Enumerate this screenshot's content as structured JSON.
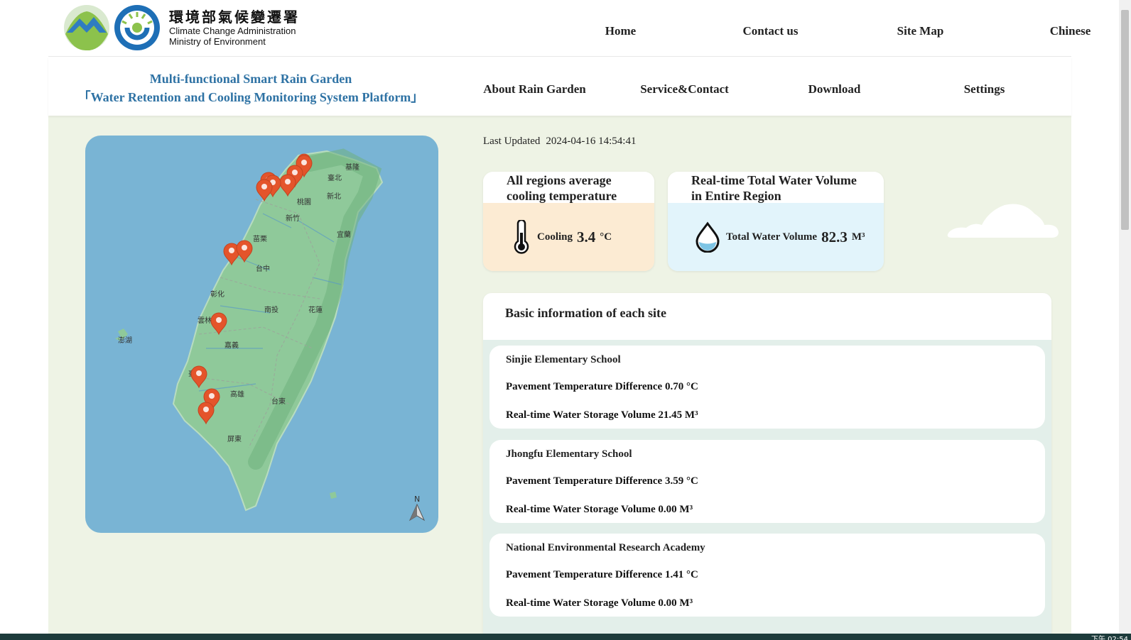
{
  "logo": {
    "name_zh": "環境部氣候變遷署",
    "name_en_1": "Climate Change Administration",
    "name_en_2": "Ministry of Environment"
  },
  "top_nav": [
    "Home",
    "Contact us",
    "Site Map",
    "Chinese"
  ],
  "platform": {
    "title_line1": "Multi-functional Smart Rain Garden",
    "title_line2": "「Water Retention and Cooling Monitoring System Platform」"
  },
  "sub_nav": [
    "About Rain Garden",
    "Service&Contact",
    "Download",
    "Settings"
  ],
  "map": {
    "labels": [
      "基隆",
      "臺北",
      "新北",
      "桃園",
      "新竹",
      "宜蘭",
      "苗栗",
      "台中",
      "彰化",
      "南投",
      "花蓮",
      "雲林",
      "嘉義",
      "澎湖",
      "臺南",
      "高雄",
      "台東",
      "屏東"
    ],
    "north_label": "N"
  },
  "last_updated": {
    "label": "Last Updated",
    "value": "2024-04-16 14:54:41"
  },
  "cooling_card": {
    "title_1": "All regions average",
    "title_2": "cooling temperature",
    "label": "Cooling",
    "value": "3.4",
    "unit": "°C"
  },
  "water_card": {
    "title_1": "Real-time Total Water Volume",
    "title_2": "in Entire Region",
    "label": "Total Water Volume",
    "value": "82.3",
    "unit": "M³"
  },
  "sites": {
    "title": "Basic information of each site",
    "items": [
      {
        "name": "Sinjie Elementary School",
        "temp": "Pavement Temperature Difference 0.70 °C",
        "water": "Real-time Water Storage Volume 21.45 M³"
      },
      {
        "name": "Jhongfu Elementary School",
        "temp": "Pavement Temperature Difference 3.59 °C",
        "water": "Real-time Water Storage Volume 0.00 M³"
      },
      {
        "name": "National Environmental Research Academy",
        "temp": "Pavement Temperature Difference 1.41 °C",
        "water": "Real-time Water Storage Volume 0.00 M³"
      }
    ]
  },
  "taskbar": {
    "clock": "下午 02:54"
  },
  "colors": {
    "title_blue": "#2e72a4",
    "main_bg": "#eef3e5",
    "cooling_bg": "#fcebd3",
    "water_bg": "#e2f4fb",
    "marker": "#e4542b",
    "sea": "#79b4d4",
    "land": "#8fc99a"
  }
}
